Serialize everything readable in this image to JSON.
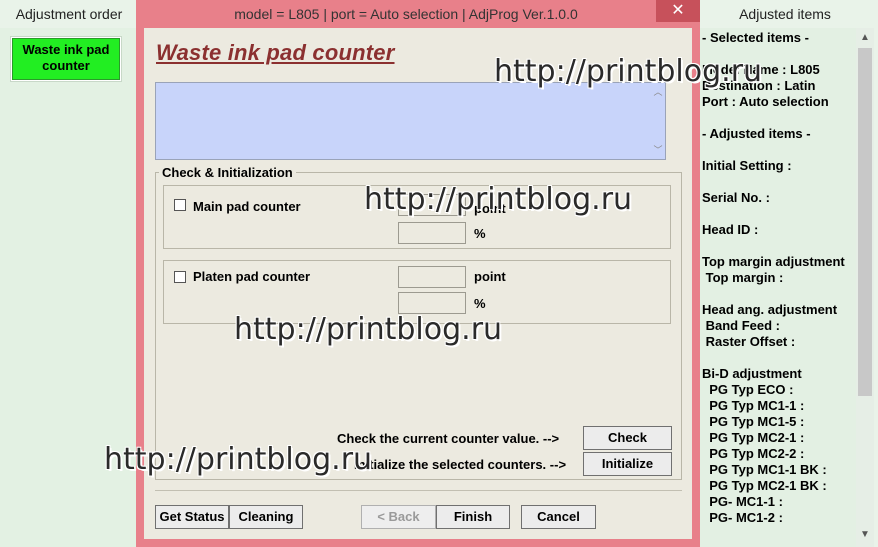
{
  "left_panel": {
    "title": "Adjustment order",
    "items": [
      {
        "label": "Waste ink pad counter"
      }
    ]
  },
  "dialog": {
    "title": "model = L805 | port = Auto selection | AdjProg Ver.1.0.0",
    "close_glyph": "✕",
    "heading": "Waste ink pad counter",
    "textbox_value": "",
    "group": {
      "label": "Check & Initialization",
      "main_pad": {
        "label": "Main pad counter",
        "checked": false,
        "unit_point": "point",
        "unit_percent": "%"
      },
      "platen_pad": {
        "label": "Platen pad counter",
        "checked": false,
        "unit_point": "point",
        "unit_percent": "%"
      },
      "check_text": "Check the current counter value. -->",
      "check_button": "Check",
      "init_text": "Initialize the selected counters. -->",
      "init_button": "Initialize"
    },
    "footer": {
      "get_status": "Get Status",
      "cleaning": "Cleaning",
      "back": "< Back",
      "finish": "Finish",
      "cancel": "Cancel"
    }
  },
  "right_panel": {
    "title": "Adjusted items",
    "lines": [
      "- Selected items -",
      "",
      "Model Name : L805",
      "Destination : Latin",
      "Port : Auto selection",
      "",
      "- Adjusted items -",
      "",
      "Initial Setting :",
      "",
      "Serial No. :",
      "",
      "Head ID :",
      "",
      "Top margin adjustment",
      " Top margin :",
      "",
      "Head ang. adjustment",
      " Band Feed :",
      " Raster Offset :",
      "",
      "Bi-D adjustment",
      "  PG Typ ECO :",
      "  PG Typ MC1-1 :",
      "  PG Typ MC1-5 :",
      "  PG Typ MC2-1 :",
      "  PG Typ MC2-2 :",
      "  PG Typ MC1-1 BK :",
      "  PG Typ MC2-1 BK :",
      "  PG- MC1-1 :",
      "  PG- MC1-2 :"
    ]
  },
  "watermarks": {
    "w1": "http://printblog.ru",
    "w2": "http://printblog.ru",
    "w3": "http://printblog.ru",
    "w4": "http://printblog.ru"
  },
  "colors": {
    "dialog_border": "#e8808a",
    "accent_green": "#22ee22",
    "heading_red": "#8b3030",
    "textbox_blue": "#c8d4fa"
  }
}
